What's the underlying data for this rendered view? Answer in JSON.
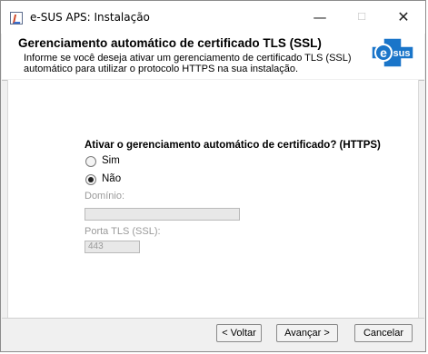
{
  "window": {
    "title": "e-SUS APS: Instalação",
    "minimize_glyph": "—",
    "maximize_glyph": "☐",
    "close_glyph": "✕"
  },
  "header": {
    "title": "Gerenciamento automático de certificado TLS (SSL)",
    "description": "Informe se você deseja ativar um gerenciamento de certificado TLS (SSL) automático para utilizar o protocolo HTTPS na sua instalação.",
    "logo_text": "sus",
    "logo_letter": "e"
  },
  "form": {
    "question": "Ativar o gerenciamento automático de certificado? (HTTPS)",
    "options": [
      {
        "label": "Sim",
        "selected": false
      },
      {
        "label": "Não",
        "selected": true
      }
    ],
    "domain_label": "Domínio:",
    "domain_value": "",
    "port_label": "Porta TLS (SSL):",
    "port_value": "443"
  },
  "buttons": {
    "back": "< Voltar",
    "next": "Avançar >",
    "cancel": "Cancelar"
  },
  "colors": {
    "logo_blue": "#1a75c9"
  }
}
